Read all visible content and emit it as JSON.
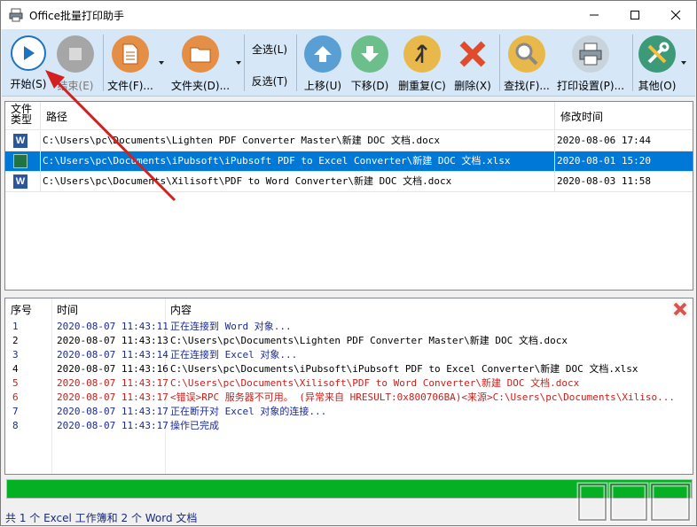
{
  "window": {
    "title": "Office批量打印助手"
  },
  "toolbar": {
    "start_label": "开始(S)",
    "end_label": "结束(E)",
    "file_label": "文件(F)...",
    "folder_label": "文件夹(D)...",
    "select_all_label": "全选(L)",
    "invert_label": "反选(T)",
    "move_up_label": "上移(U)",
    "move_down_label": "下移(D)",
    "delete_dup_label": "删重复(C)",
    "delete_label": "删除(X)",
    "find_label": "查找(F)...",
    "print_settings_label": "打印设置(P)...",
    "other_label": "其他(O)"
  },
  "file_list": {
    "headers": {
      "type": "文件\n类型",
      "path": "路径",
      "modified": "修改时间"
    },
    "rows": [
      {
        "type": "word-icon",
        "path": "C:\\Users\\pc\\Documents\\Lighten PDF Converter Master\\新建 DOC 文档.docx",
        "modified": "2020-08-06 17:44",
        "selected": false
      },
      {
        "type": "excel-icon",
        "path": "C:\\Users\\pc\\Documents\\iPubsoft\\iPubsoft PDF to Excel Converter\\新建 DOC 文档.xlsx",
        "modified": "2020-08-01 15:20",
        "selected": true
      },
      {
        "type": "word-icon",
        "path": "C:\\Users\\pc\\Documents\\Xilisoft\\PDF to Word Converter\\新建 DOC 文档.docx",
        "modified": "2020-08-03 11:58",
        "selected": false
      }
    ]
  },
  "log": {
    "headers": {
      "seq": "序号",
      "time": "时间",
      "content": "内容"
    },
    "rows": [
      {
        "seq": "1",
        "time": "2020-08-07 11:43:11",
        "content": "正在连接到 Word 对象...",
        "color": "#1a2a9a"
      },
      {
        "seq": "2",
        "time": "2020-08-07 11:43:13",
        "content": "C:\\Users\\pc\\Documents\\Lighten PDF Converter Master\\新建 DOC 文档.docx",
        "color": "#000000"
      },
      {
        "seq": "3",
        "time": "2020-08-07 11:43:14",
        "content": "正在连接到 Excel 对象...",
        "color": "#1a2a9a"
      },
      {
        "seq": "4",
        "time": "2020-08-07 11:43:16",
        "content": "C:\\Users\\pc\\Documents\\iPubsoft\\iPubsoft PDF to Excel Converter\\新建 DOC 文档.xlsx",
        "color": "#000000"
      },
      {
        "seq": "5",
        "time": "2020-08-07 11:43:17",
        "content": "C:\\Users\\pc\\Documents\\Xilisoft\\PDF to Word Converter\\新建 DOC 文档.docx",
        "color": "#c8201c"
      },
      {
        "seq": "6",
        "time": "2020-08-07 11:43:17",
        "content": "<错误>RPC 服务器不可用。 (异常来自 HRESULT:0x800706BA)<来源>C:\\Users\\pc\\Documents\\Xiliso...",
        "color": "#c8201c"
      },
      {
        "seq": "7",
        "time": "2020-08-07 11:43:17",
        "content": "正在断开对 Excel 对象的连接...",
        "color": "#1a2a9a"
      },
      {
        "seq": "8",
        "time": "2020-08-07 11:43:17",
        "content": "操作已完成",
        "color": "#1a2a9a"
      }
    ]
  },
  "progress": {
    "percent": 100,
    "color": "#06b025"
  },
  "status": {
    "text": "共 1 个 Excel 工作簿和 2 个 Word 文档"
  },
  "colors": {
    "selection": "#0078d7",
    "toolbar_bg": "#d6e7f7",
    "annotation_arrow": "#d42020"
  }
}
